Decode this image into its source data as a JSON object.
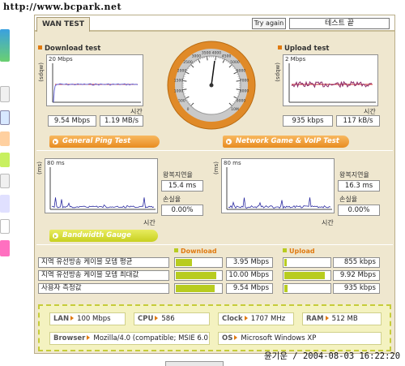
{
  "watermark": "http://www.bcpark.net",
  "toolbar": {
    "tab": "WAN TEST",
    "try_again": "Try again",
    "quit": "테스트 끝"
  },
  "download": {
    "title": "Download test",
    "scale": "20 Mbps",
    "unit_axis": "(sdqw)",
    "time_label": "시간",
    "value_mbps": "9.54 Mbps",
    "value_mbs": "1.19 MB/s"
  },
  "upload": {
    "title": "Upload test",
    "scale": "2 Mbps",
    "unit_axis": "(sdqw)",
    "time_label": "시간",
    "value_kbps": "935 kbps",
    "value_kbs": "117 kB/s"
  },
  "speedometer": {
    "ticks": [
      "0",
      "500",
      "1000",
      "1500",
      "2000",
      "2500",
      "3000",
      "3500",
      "4000",
      "4500",
      "5000",
      "6000",
      "7000",
      "8000",
      "9000",
      "10M"
    ]
  },
  "ping": {
    "bar_label": "General Ping Test",
    "scale": "80 ms",
    "unit_axis": "(ms)",
    "time_label": "시간",
    "rtt_label": "왕복지연율",
    "rtt_value": "15.4 ms",
    "loss_label": "손실율",
    "loss_value": "0.00%"
  },
  "game": {
    "bar_label": "Network Game & VoIP Test",
    "scale": "80 ms",
    "unit_axis": "(ms)",
    "time_label": "시간",
    "rtt_label": "왕복지연율",
    "rtt_value": "16.3 ms",
    "loss_label": "손실율",
    "loss_value": "0.00%"
  },
  "bandwidth": {
    "bar_label": "Bandwidth Gauge",
    "download_head": "Download",
    "upload_head": "Upload",
    "rows": [
      {
        "label": "지역 유선방송 케이블 모뎀 평균",
        "down": "3.95 Mbps",
        "down_frac": 0.34,
        "up": "855 kbps",
        "up_frac": 0.06
      },
      {
        "label": "지역 유선방송 케이블 모뎀 최대값",
        "down": "10.00 Mbps",
        "down_frac": 0.86,
        "up": "9.92 Mbps",
        "up_frac": 0.86
      },
      {
        "label": "사용자 측정값",
        "down": "9.54 Mbps",
        "down_frac": 0.82,
        "up": "935 kbps",
        "up_frac": 0.07
      }
    ]
  },
  "system": {
    "lan_key": "LAN",
    "lan": "100 Mbps",
    "cpu_key": "CPU",
    "cpu": "586",
    "clock_key": "Clock",
    "clock": "1707 MHz",
    "ram_key": "RAM",
    "ram": "512 MB",
    "browser_key": "Browser",
    "browser": "Mozilla/4.0 (compatible; MSIE 6.0",
    "os_key": "OS",
    "os": "Microsoft Windows XP"
  },
  "stamp": "윤기운 / 2004-08-03 16:22:20",
  "colors": {
    "panel": "#efe7cf",
    "accent_orange": "#e88c20",
    "gauge_green": "#b8cc20",
    "download_line": "#6a6ad8",
    "download_avg": "#cc2a2a"
  }
}
